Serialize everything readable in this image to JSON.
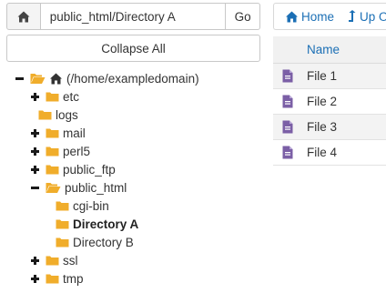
{
  "colors": {
    "folder": "#f0ad2b",
    "home_icon": "#333333",
    "file_icon": "#7b5fa6",
    "link": "#1b6fb5"
  },
  "pathbar": {
    "home_icon": "home-icon",
    "path_value": "public_html/Directory A",
    "go_label": "Go"
  },
  "collapse_label": "Collapse All",
  "tree": {
    "root_label": "(/home/exampledomain)",
    "items": {
      "etc": "etc",
      "logs": "logs",
      "mail": "mail",
      "perl5": "perl5",
      "public_ftp": "public_ftp",
      "public_html": "public_html",
      "cgi_bin": "cgi-bin",
      "directory_a": "Directory A",
      "directory_b": "Directory B",
      "ssl": "ssl",
      "tmp": "tmp"
    }
  },
  "toolbar": {
    "home_label": "Home",
    "up_label": "Up One Level"
  },
  "table": {
    "header_name": "Name",
    "rows": [
      "File 1",
      "File 2",
      "File 3",
      "File 4"
    ]
  }
}
